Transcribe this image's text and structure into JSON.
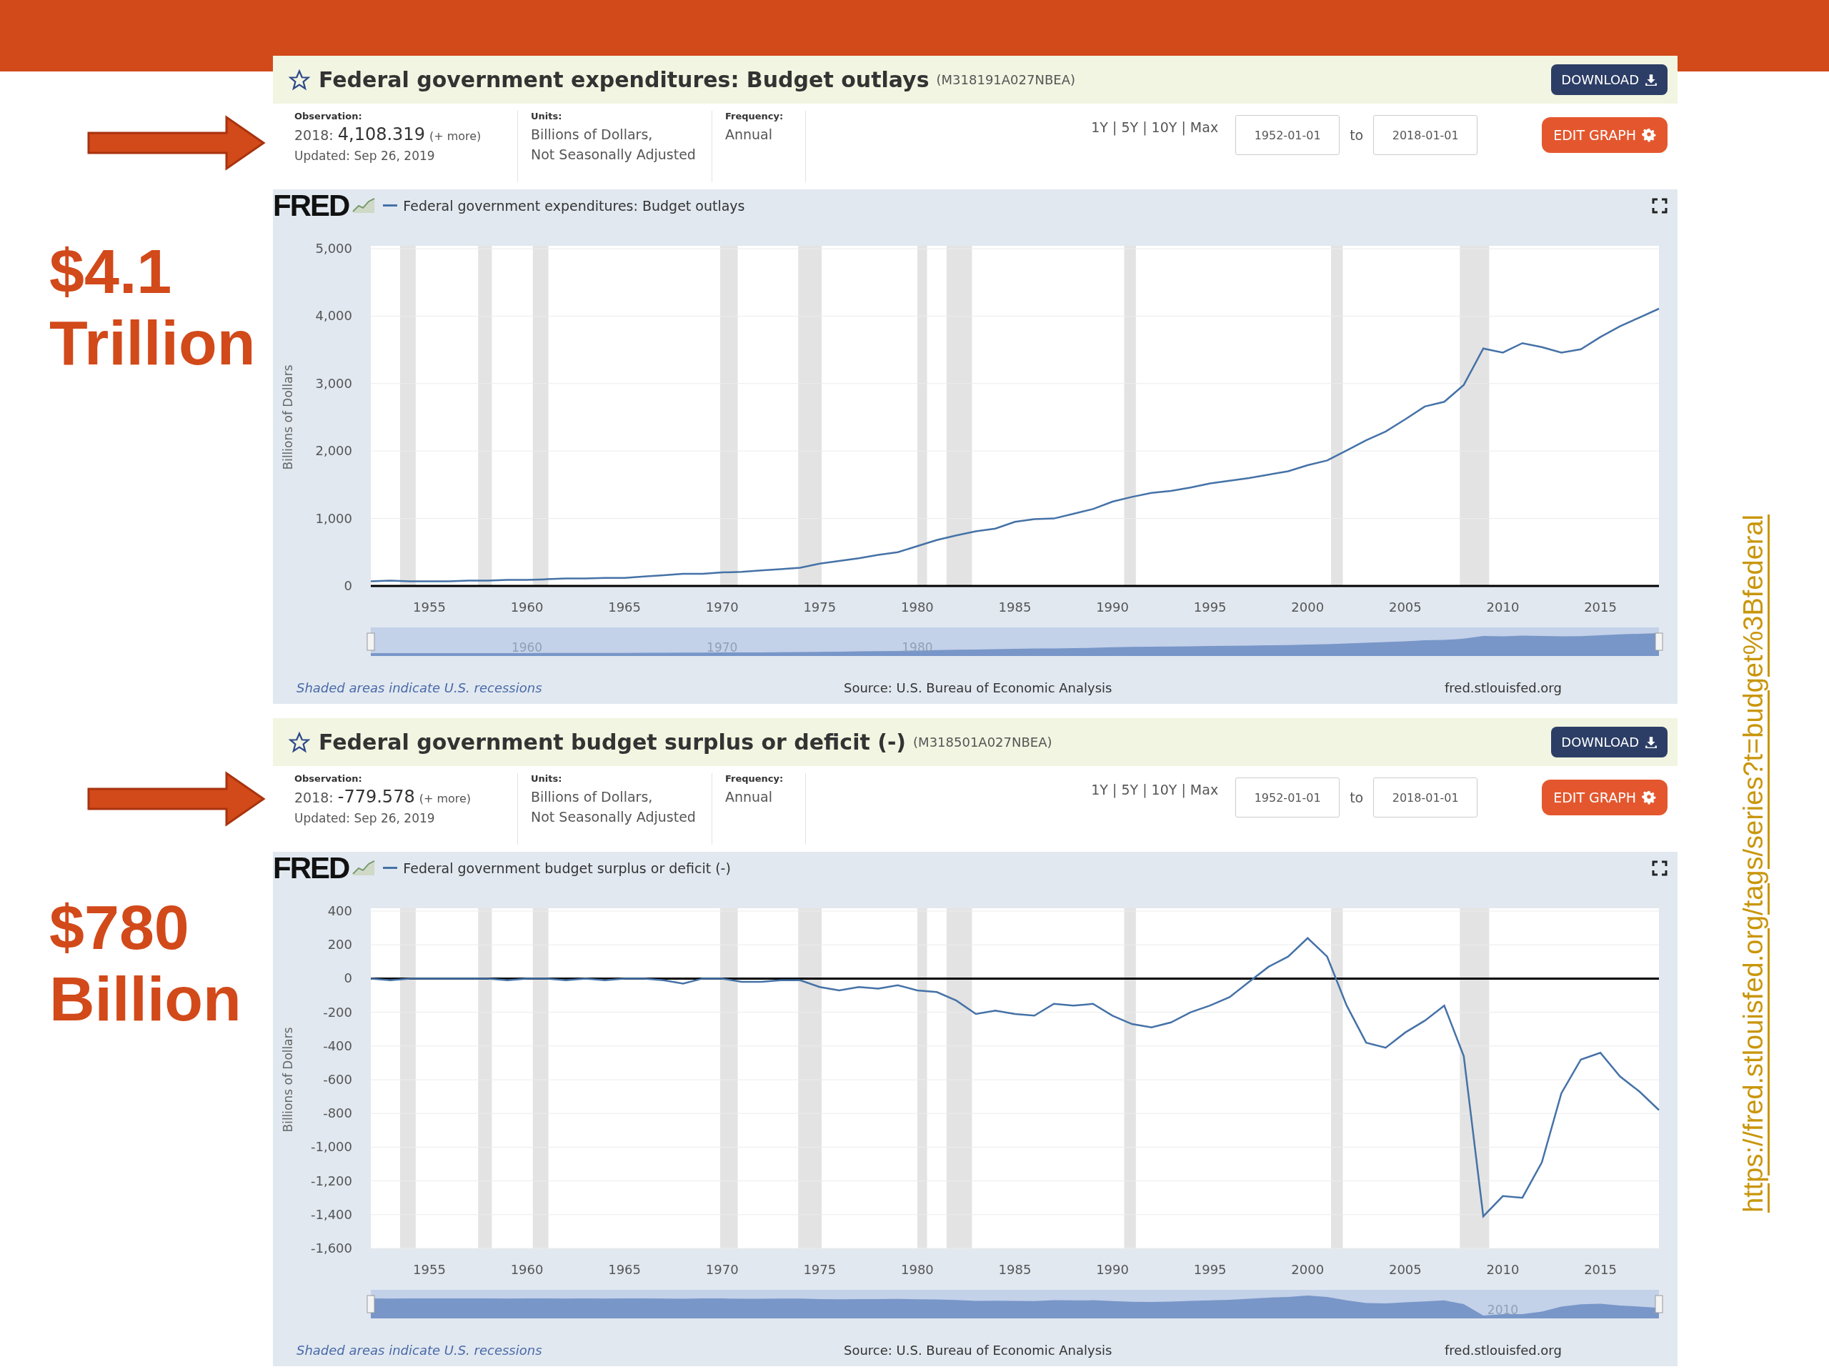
{
  "slide": {
    "callouts": [
      {
        "lines": [
          "$4.1",
          "Trillion"
        ]
      },
      {
        "lines": [
          "$780",
          "Billion"
        ]
      }
    ],
    "source_link": "https://fred.stlouisfed.org/tags/series?t=budget%3Bfederal"
  },
  "panels": [
    {
      "title": "Federal government expenditures: Budget outlays",
      "series_id": "(M318191A027NBEA)",
      "download_button": "DOWNLOAD",
      "observation": {
        "label": "Observation:",
        "date": "2018:",
        "value": "4,108.319",
        "more": "(+ more)",
        "updated": "Updated: Sep 26, 2019"
      },
      "units": {
        "label": "Units:",
        "lines": [
          "Billions of Dollars,",
          "Not Seasonally Adjusted"
        ]
      },
      "frequency": {
        "label": "Frequency:",
        "value": "Annual"
      },
      "range_links": "1Y | 5Y | 10Y | Max",
      "start_date": "1952-01-01",
      "to_label": "to",
      "end_date": "2018-01-01",
      "edit_button": "EDIT GRAPH",
      "logo": "FRED",
      "chart_data": {
        "type": "line",
        "ylabel": "Billions of Dollars",
        "grid": true,
        "x": [
          1952,
          1953,
          1954,
          1955,
          1956,
          1957,
          1958,
          1959,
          1960,
          1961,
          1962,
          1963,
          1964,
          1965,
          1966,
          1967,
          1968,
          1969,
          1970,
          1971,
          1972,
          1973,
          1974,
          1975,
          1976,
          1977,
          1978,
          1979,
          1980,
          1981,
          1982,
          1983,
          1984,
          1985,
          1986,
          1987,
          1988,
          1989,
          1990,
          1991,
          1992,
          1993,
          1994,
          1995,
          1996,
          1997,
          1998,
          1999,
          2000,
          2001,
          2002,
          2003,
          2004,
          2005,
          2006,
          2007,
          2008,
          2009,
          2010,
          2011,
          2012,
          2013,
          2014,
          2015,
          2016,
          2017,
          2018
        ],
        "series": [
          {
            "name": "Federal government expenditures: Budget outlays",
            "color": "#4572a7",
            "values": [
              70,
              80,
              70,
              70,
              70,
              80,
              80,
              90,
              90,
              100,
              110,
              110,
              120,
              120,
              140,
              160,
              180,
              180,
              200,
              210,
              230,
              250,
              270,
              330,
              370,
              410,
              460,
              500,
              590,
              680,
              750,
              810,
              850,
              950,
              990,
              1000,
              1070,
              1140,
              1250,
              1320,
              1380,
              1410,
              1460,
              1520,
              1560,
              1600,
              1650,
              1700,
              1790,
              1860,
              2010,
              2160,
              2290,
              2470,
              2660,
              2730,
              2980,
              3520,
              3460,
              3600,
              3540,
              3460,
              3510,
              3690,
              3850,
              3980,
              4110
            ]
          }
        ],
        "xlim": [
          1952,
          2018
        ],
        "ylim": [
          0,
          5000
        ],
        "xticks": [
          1955,
          1960,
          1965,
          1970,
          1975,
          1980,
          1985,
          1990,
          1995,
          2000,
          2005,
          2010,
          2015
        ],
        "yticks": [
          0,
          {
            "value": 1000,
            "label": "1,000"
          },
          {
            "value": 2000,
            "label": "2,000"
          },
          {
            "value": 3000,
            "label": "3,000"
          },
          {
            "value": 4000,
            "label": "4,000"
          },
          {
            "value": 5000,
            "label": "5,000"
          }
        ],
        "bands": [
          {
            "axis": "x",
            "from": 1953.5,
            "to": 1954.3
          },
          {
            "axis": "x",
            "from": 1957.5,
            "to": 1958.2
          },
          {
            "axis": "x",
            "from": 1960.3,
            "to": 1961.1
          },
          {
            "axis": "x",
            "from": 1969.9,
            "to": 1970.8
          },
          {
            "axis": "x",
            "from": 1973.9,
            "to": 1975.1
          },
          {
            "axis": "x",
            "from": 1980.0,
            "to": 1980.5
          },
          {
            "axis": "x",
            "from": 1981.5,
            "to": 1982.8
          },
          {
            "axis": "x",
            "from": 1990.6,
            "to": 1991.2
          },
          {
            "axis": "x",
            "from": 2001.2,
            "to": 2001.8
          },
          {
            "axis": "x",
            "from": 2007.8,
            "to": 2009.3
          }
        ]
      },
      "navigator_labels": [
        "1960",
        "1970",
        "1980"
      ],
      "footer": {
        "note": "Shaded areas indicate U.S. recessions",
        "source": "Source: U.S. Bureau of Economic Analysis",
        "site": "fred.stlouisfed.org"
      }
    },
    {
      "title": "Federal government budget surplus or deficit (-)",
      "series_id": "(M318501A027NBEA)",
      "download_button": "DOWNLOAD",
      "observation": {
        "label": "Observation:",
        "date": "2018:",
        "value": "-779.578",
        "more": "(+ more)",
        "updated": "Updated: Sep 26, 2019"
      },
      "units": {
        "label": "Units:",
        "lines": [
          "Billions of Dollars,",
          "Not Seasonally Adjusted"
        ]
      },
      "frequency": {
        "label": "Frequency:",
        "value": "Annual"
      },
      "range_links": "1Y | 5Y | 10Y | Max",
      "start_date": "1952-01-01",
      "to_label": "to",
      "end_date": "2018-01-01",
      "edit_button": "EDIT GRAPH",
      "logo": "FRED",
      "chart_data": {
        "type": "line",
        "ylabel": "Billions of Dollars",
        "grid": true,
        "x": [
          1952,
          1953,
          1954,
          1955,
          1956,
          1957,
          1958,
          1959,
          1960,
          1961,
          1962,
          1963,
          1964,
          1965,
          1966,
          1967,
          1968,
          1969,
          1970,
          1971,
          1972,
          1973,
          1974,
          1975,
          1976,
          1977,
          1978,
          1979,
          1980,
          1981,
          1982,
          1983,
          1984,
          1985,
          1986,
          1987,
          1988,
          1989,
          1990,
          1991,
          1992,
          1993,
          1994,
          1995,
          1996,
          1997,
          1998,
          1999,
          2000,
          2001,
          2002,
          2003,
          2004,
          2005,
          2006,
          2007,
          2008,
          2009,
          2010,
          2011,
          2012,
          2013,
          2014,
          2015,
          2016,
          2017,
          2018
        ],
        "series": [
          {
            "name": "Federal government budget surplus or deficit (-)",
            "color": "#4572a7",
            "values": [
              0,
              -10,
              0,
              0,
              0,
              0,
              0,
              -10,
              0,
              0,
              -10,
              0,
              -10,
              0,
              0,
              -10,
              -30,
              0,
              0,
              -20,
              -20,
              -10,
              -10,
              -50,
              -70,
              -50,
              -60,
              -40,
              -70,
              -80,
              -130,
              -210,
              -190,
              -210,
              -220,
              -150,
              -160,
              -150,
              -220,
              -270,
              -290,
              -260,
              -200,
              -160,
              -110,
              -20,
              70,
              130,
              240,
              130,
              -160,
              -380,
              -410,
              -320,
              -250,
              -160,
              -460,
              -1410,
              -1290,
              -1300,
              -1090,
              -680,
              -480,
              -440,
              -580,
              -670,
              -780
            ]
          }
        ],
        "xlim": [
          1952,
          2018
        ],
        "ylim": [
          -1600,
          400
        ],
        "xticks": [
          1955,
          1960,
          1965,
          1970,
          1975,
          1980,
          1985,
          1990,
          1995,
          2000,
          2005,
          2010,
          2015
        ],
        "yticks": [
          {
            "value": -1600,
            "label": "-1,600"
          },
          {
            "value": -1400,
            "label": "-1,400"
          },
          {
            "value": -1200,
            "label": "-1,200"
          },
          {
            "value": -1000,
            "label": "-1,000"
          },
          -800,
          -600,
          -400,
          -200,
          0,
          200,
          400
        ],
        "bands": [
          {
            "axis": "x",
            "from": 1953.5,
            "to": 1954.3
          },
          {
            "axis": "x",
            "from": 1957.5,
            "to": 1958.2
          },
          {
            "axis": "x",
            "from": 1960.3,
            "to": 1961.1
          },
          {
            "axis": "x",
            "from": 1969.9,
            "to": 1970.8
          },
          {
            "axis": "x",
            "from": 1973.9,
            "to": 1975.1
          },
          {
            "axis": "x",
            "from": 1980.0,
            "to": 1980.5
          },
          {
            "axis": "x",
            "from": 1981.5,
            "to": 1982.8
          },
          {
            "axis": "x",
            "from": 1990.6,
            "to": 1991.2
          },
          {
            "axis": "x",
            "from": 2001.2,
            "to": 2001.8
          },
          {
            "axis": "x",
            "from": 2007.8,
            "to": 2009.3
          }
        ]
      },
      "navigator_labels": [
        "2010"
      ],
      "footer": {
        "note": "Shaded areas indicate U.S. recessions",
        "source": "Source: U.S. Bureau of Economic Analysis",
        "site": "fred.stlouisfed.org"
      }
    }
  ]
}
